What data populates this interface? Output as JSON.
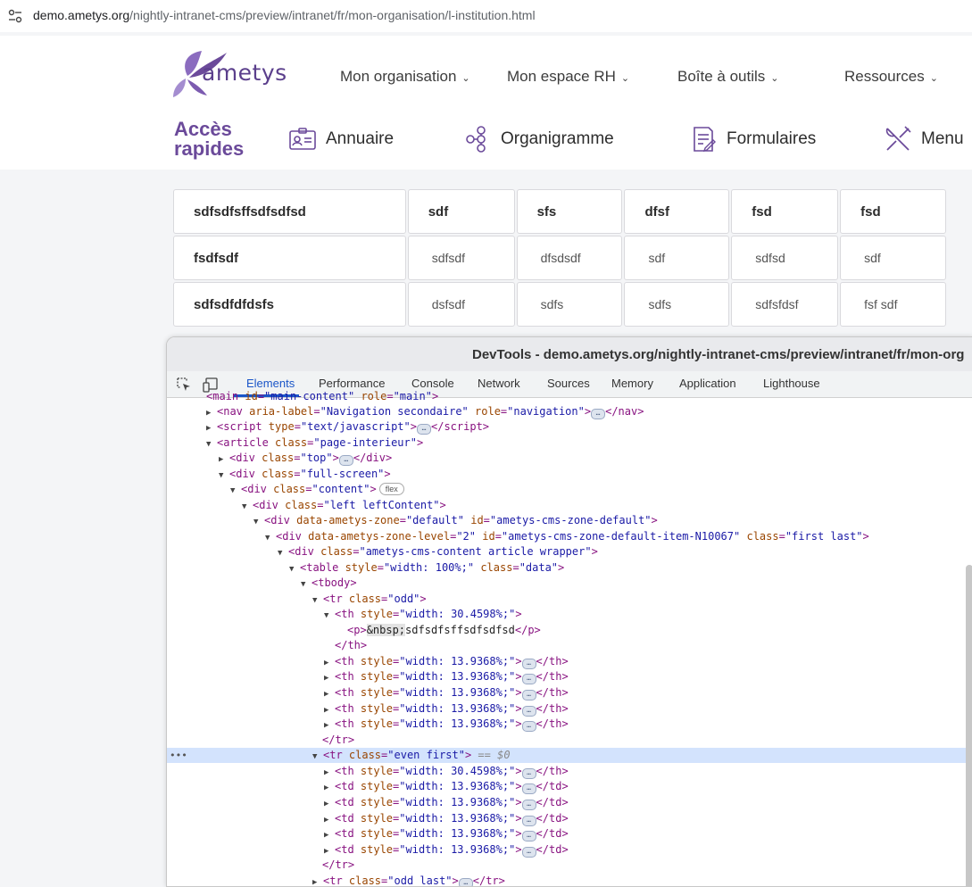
{
  "browser": {
    "url_host": "demo.ametys.org",
    "url_path": "/nightly-intranet-cms/preview/intranet/fr/mon-organisation/l-institution.html"
  },
  "header": {
    "logo_text": "ametys",
    "nav": [
      {
        "label": "Mon organisation"
      },
      {
        "label": "Mon espace RH"
      },
      {
        "label": "Boîte à outils"
      },
      {
        "label": "Ressources"
      }
    ],
    "acces_rapides_line1": "Accès",
    "acces_rapides_line2": "rapides",
    "quick_links": [
      {
        "label": "Annuaire",
        "icon": "id-card-icon"
      },
      {
        "label": "Organigramme",
        "icon": "org-chart-icon"
      },
      {
        "label": "Formulaires",
        "icon": "form-icon"
      },
      {
        "label": "Menu",
        "icon": "fork-knife-icon"
      }
    ]
  },
  "table": {
    "rows": [
      {
        "cells": [
          "sdfsdfsffsdfsdfsd",
          "sdf",
          "sfs",
          "dfsf",
          "fsd",
          "fsd"
        ]
      },
      {
        "cells": [
          "fsdfsdf",
          "sdfsdf",
          "dfsdsdf",
          "sdf",
          "sdfsd",
          "sdf"
        ]
      },
      {
        "cells": [
          "sdfsdfdfdsfs",
          "dsfsdf",
          "sdfs",
          "sdfs",
          "sdfsfdsf",
          "fsf sdf"
        ]
      }
    ]
  },
  "devtools": {
    "title": "DevTools - demo.ametys.org/nightly-intranet-cms/preview/intranet/fr/mon-org",
    "tabs": [
      "Elements",
      "Performance",
      "Console",
      "Network",
      "Sources",
      "Memory",
      "Application",
      "Lighthouse"
    ],
    "flex_badge": "flex",
    "selected_marker": "== $0",
    "row_dots": "•••"
  },
  "colors": {
    "brand_purple": "#6b4a9a",
    "devtools_accent": "#1a55c8",
    "selection": "#d3e3fd"
  }
}
